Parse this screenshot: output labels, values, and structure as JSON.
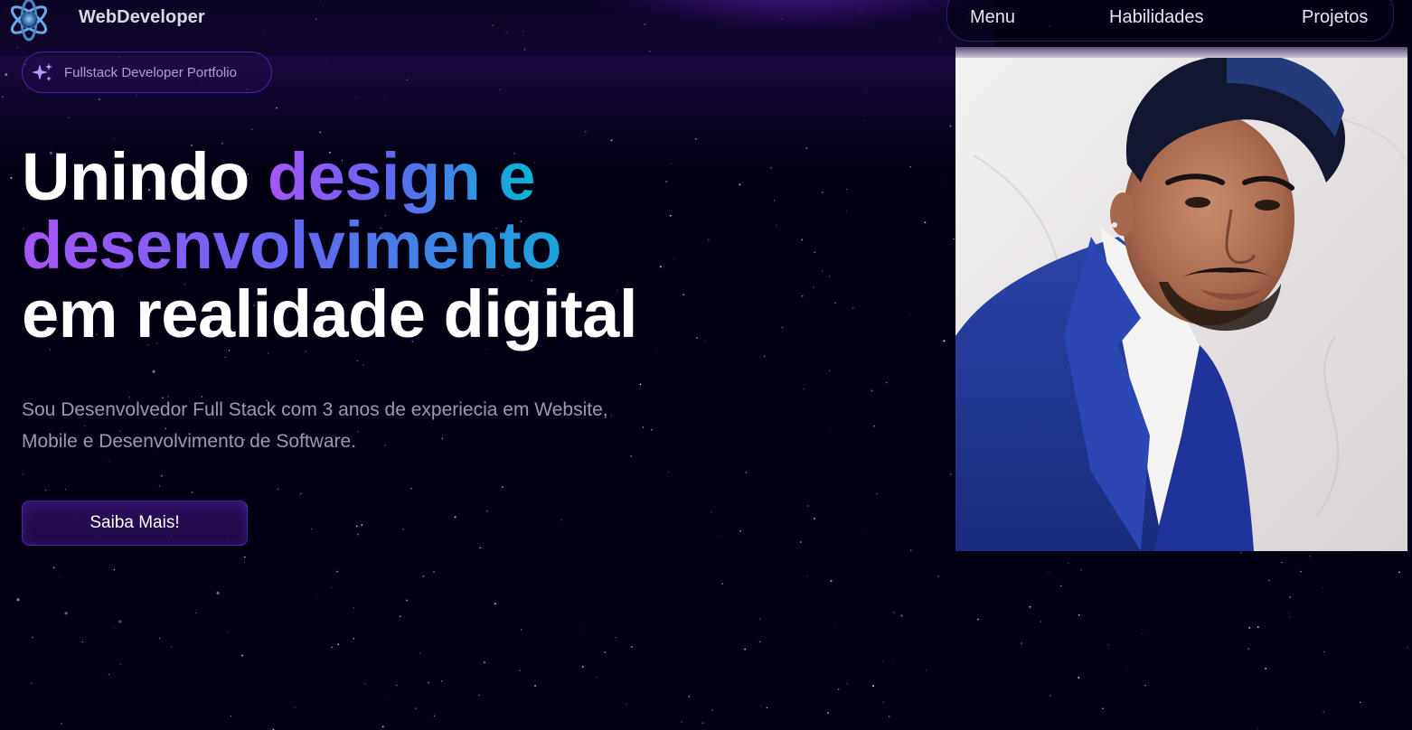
{
  "navbar": {
    "brand": "WebDeveloper",
    "logo_icon": "atom-icon",
    "links": [
      {
        "label": "Menu"
      },
      {
        "label": "Habilidades"
      },
      {
        "label": "Projetos"
      }
    ]
  },
  "hero": {
    "badge": {
      "icon": "sparkles-icon",
      "text": "Fullstack Developer Portfolio"
    },
    "headline": {
      "part1": "Unindo ",
      "part2_highlight": "design e",
      "part3_highlight": "desenvolvimento",
      "part4": "em realidade digital"
    },
    "description_line1": "Sou Desenvolvedor Full Stack com 3 anos de experiecia em Website,",
    "description_line2": "Mobile e Desenvolvimento de Software.",
    "cta_label": "Saiba Mais!"
  },
  "portrait": {
    "subject": "man-in-blue-suit-photo"
  },
  "colors": {
    "background": "#030014",
    "accent_purple": "#a855f7",
    "accent_indigo": "#6366f1",
    "accent_cyan": "#06b6d4",
    "border_purple": "#7042f8"
  }
}
